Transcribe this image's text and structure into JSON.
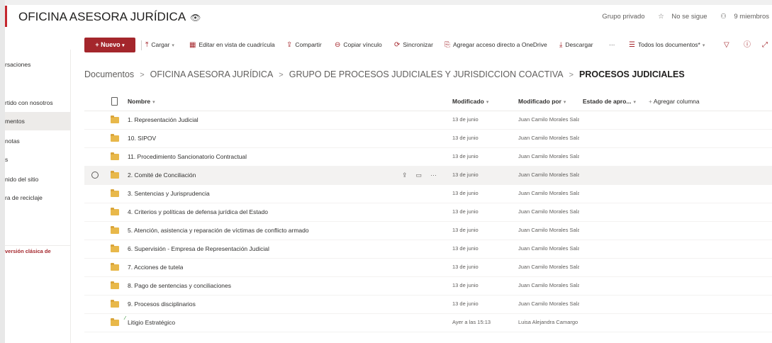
{
  "site": {
    "title": "OFICINA ASESORA JURÍDICA",
    "privacy": "Grupo privado",
    "follow": "No se sigue",
    "members": "9 miembros"
  },
  "leftnav": {
    "items": [
      {
        "label": "rsaciones"
      },
      {
        "label": "rtido con nosotros"
      },
      {
        "label": "mentos"
      },
      {
        "label": "notas"
      },
      {
        "label": "s"
      },
      {
        "label": "nido del sitio"
      },
      {
        "label": "ra de reciclaje"
      }
    ],
    "classic": "versión clásica de"
  },
  "commandbar": {
    "new": "Nuevo",
    "upload": "Cargar",
    "grid": "Editar en vista de cuadrícula",
    "share": "Compartir",
    "copy_link": "Copiar vínculo",
    "sync": "Sincronizar",
    "shortcut": "Agregar acceso directo a OneDrive",
    "download": "Descargar",
    "more": "···",
    "view": "Todos los documentos*"
  },
  "breadcrumb": {
    "items": [
      "Documentos",
      "OFICINA ASESORA JURÍDICA",
      "GRUPO DE PROCESOS JUDICIALES Y JURISDICCION COACTIVA"
    ],
    "current": "PROCESOS JUDICIALES"
  },
  "table": {
    "columns": {
      "name": "Nombre",
      "modified": "Modificado",
      "modified_by": "Modificado por",
      "approval": "Estado de apro...",
      "add_column": "Agregar columna"
    },
    "rows": [
      {
        "name": "1. Representación Judicial",
        "modified": "13 de junio",
        "by": "Juan Camilo Morales Salaz"
      },
      {
        "name": "10. SIPOV",
        "modified": "13 de junio",
        "by": "Juan Camilo Morales Salaz"
      },
      {
        "name": "11. Procedimiento Sancionatorio Contractual",
        "modified": "13 de junio",
        "by": "Juan Camilo Morales Salaz"
      },
      {
        "name": "2. Comité de Conciliación",
        "modified": "13 de junio",
        "by": "Juan Camilo Morales Salaz"
      },
      {
        "name": "3. Sentencias y Jurisprudencia",
        "modified": "13 de junio",
        "by": "Juan Camilo Morales Salaz"
      },
      {
        "name": "4. Criterios y políticas de defensa jurídica del Estado",
        "modified": "13 de junio",
        "by": "Juan Camilo Morales Salaz"
      },
      {
        "name": "5. Atención, asistencia y reparación de víctimas de conflicto armado",
        "modified": "13 de junio",
        "by": "Juan Camilo Morales Salaz"
      },
      {
        "name": "6. Supervisión - Empresa de Representación Judicial",
        "modified": "13 de junio",
        "by": "Juan Camilo Morales Salaz"
      },
      {
        "name": "7. Acciones de tutela",
        "modified": "13 de junio",
        "by": "Juan Camilo Morales Salaz"
      },
      {
        "name": "8. Pago de sentencias y conciliaciones",
        "modified": "13 de junio",
        "by": "Juan Camilo Morales Salaz"
      },
      {
        "name": "9. Procesos disciplinarios",
        "modified": "13 de junio",
        "by": "Juan Camilo Morales Salaz"
      },
      {
        "name": "Litigio Estratégico",
        "modified": "Ayer a las 15:13",
        "by": "Luisa Alejandra Camargo S"
      }
    ]
  },
  "colors": {
    "accent": "#a4262c",
    "folder": "#e8b84a"
  }
}
